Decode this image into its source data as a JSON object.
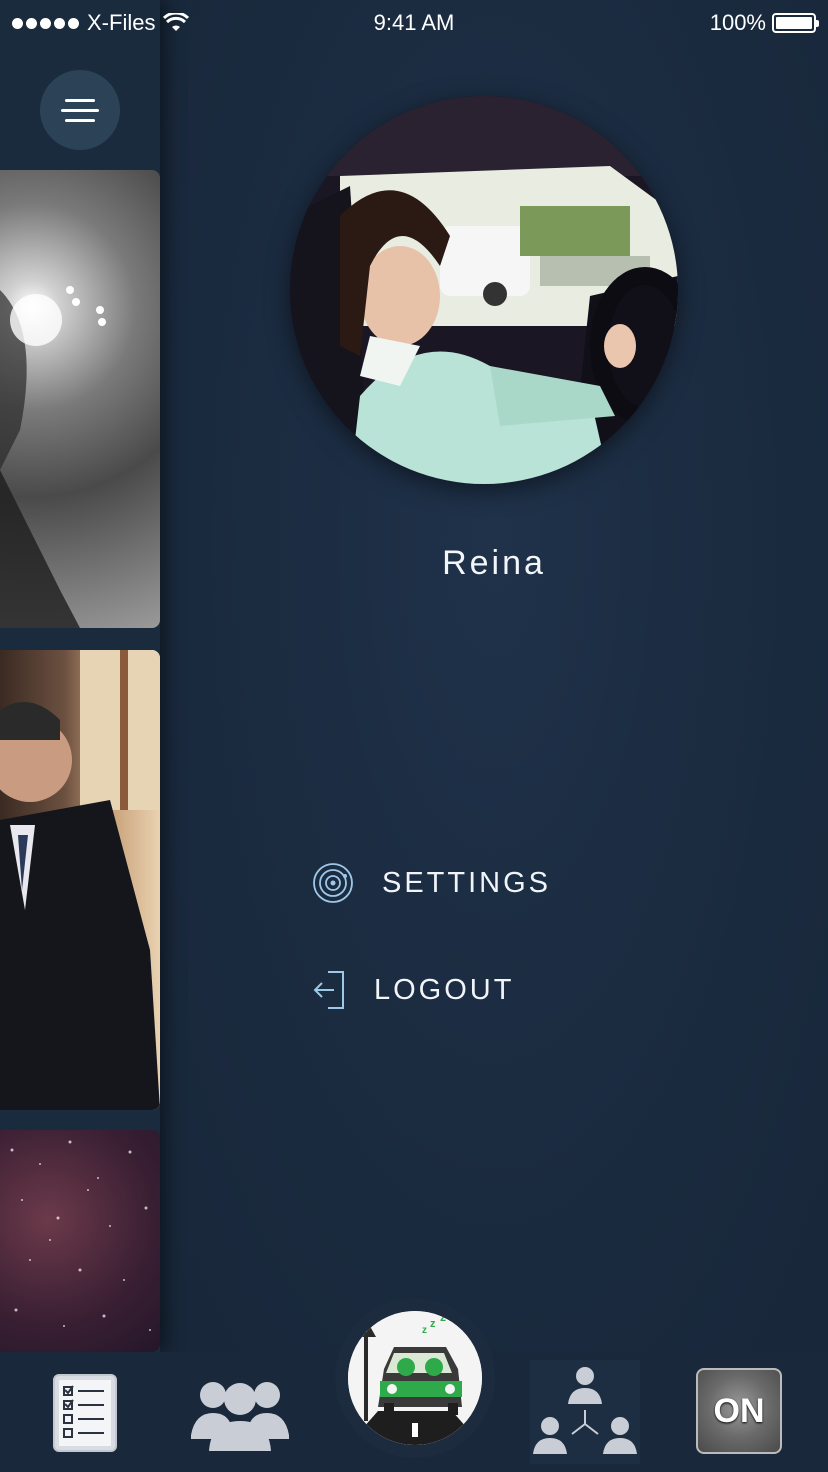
{
  "status_bar": {
    "carrier": "X-Files",
    "time": "9:41 AM",
    "battery": "100%"
  },
  "profile": {
    "name": "Reina"
  },
  "menu": {
    "settings_label": "SETTINGS",
    "logout_label": "LOGOUT"
  },
  "tab_bar": {
    "on_button_label": "ON"
  },
  "colors": {
    "background": "#1b2a3d",
    "tab_bar": "#19283a",
    "menu_button": "#2c4257",
    "accent_green": "#2eaa4a",
    "icon_line": "#9fc8e8"
  }
}
